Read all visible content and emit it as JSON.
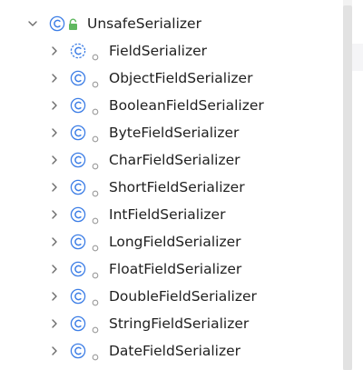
{
  "colors": {
    "class_icon": "#3d7ee6",
    "lock_icon": "#5fb85f",
    "chevron": "#6b6b6b",
    "dot": "#9a9a9a",
    "text": "#1f1f1f"
  },
  "tree": {
    "root": {
      "label": "UnsafeSerializer",
      "expanded": true,
      "icon": "class-icon",
      "modifier_icon": "lock-icon"
    },
    "children": [
      {
        "label": "FieldSerializer",
        "icon": "abstract-class-icon"
      },
      {
        "label": "ObjectFieldSerializer",
        "icon": "class-icon"
      },
      {
        "label": "BooleanFieldSerializer",
        "icon": "class-icon"
      },
      {
        "label": "ByteFieldSerializer",
        "icon": "class-icon"
      },
      {
        "label": "CharFieldSerializer",
        "icon": "class-icon"
      },
      {
        "label": "ShortFieldSerializer",
        "icon": "class-icon"
      },
      {
        "label": "IntFieldSerializer",
        "icon": "class-icon"
      },
      {
        "label": "LongFieldSerializer",
        "icon": "class-icon"
      },
      {
        "label": "FloatFieldSerializer",
        "icon": "class-icon"
      },
      {
        "label": "DoubleFieldSerializer",
        "icon": "class-icon"
      },
      {
        "label": "StringFieldSerializer",
        "icon": "class-icon"
      },
      {
        "label": "DateFieldSerializer",
        "icon": "class-icon"
      }
    ]
  }
}
